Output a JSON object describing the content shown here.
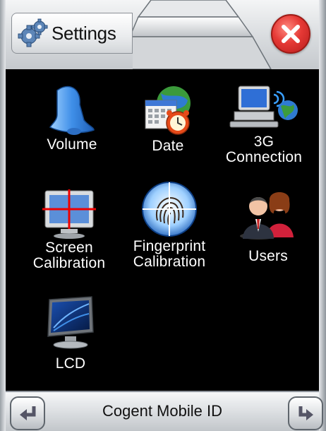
{
  "header": {
    "title": "Settings",
    "icons": {
      "settings": "gear-icon",
      "close": "close-icon"
    },
    "close_color": "#e53935"
  },
  "items": [
    {
      "label": "Volume",
      "icon": "bell-icon"
    },
    {
      "label": "Date",
      "icon": "calendar-clock-icon"
    },
    {
      "label_line1": "3G",
      "label_line2": "Connection",
      "icon": "computer-globe-icon"
    },
    {
      "label_line1": "Screen",
      "label_line2": "Calibration",
      "icon": "monitor-crosshair-icon"
    },
    {
      "label_line1": "Fingerprint",
      "label_line2": "Calibration",
      "icon": "fingerprint-icon"
    },
    {
      "label": "Users",
      "icon": "users-icon"
    },
    {
      "label": "LCD",
      "icon": "lcd-monitor-icon"
    }
  ],
  "footer": {
    "title": "Cogent Mobile ID",
    "back_icon": "back-arrow-icon",
    "forward_icon": "forward-arrow-icon"
  }
}
